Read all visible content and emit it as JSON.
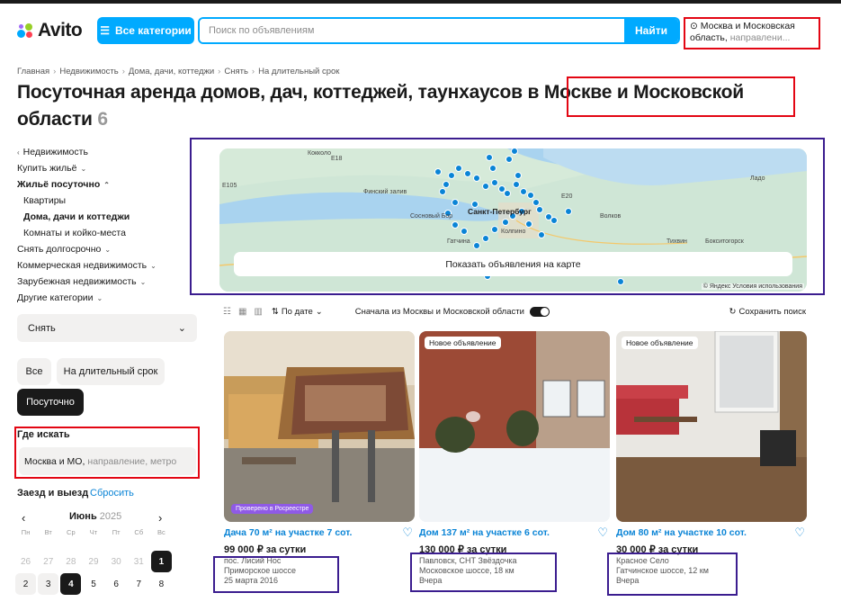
{
  "header": {
    "logo_text": "Avito",
    "categories_button": "Все категории",
    "search_placeholder": "Поиск по объявлениям",
    "search_button": "Найти",
    "location_main": "Москва и Московская",
    "location_line2_a": "область,",
    "location_line2_b": "направлени..."
  },
  "breadcrumb": [
    "Главная",
    "Недвижимость",
    "Дома, дачи, коттеджи",
    "Снять",
    "На длительный срок"
  ],
  "page": {
    "title": "Посуточная аренда домов, дач, коттеджей, таунхаусов в Москве и Московской области",
    "count": "6"
  },
  "sidebar": {
    "items": [
      {
        "label": "Недвижимость",
        "prefix": "‹"
      },
      {
        "label": "Купить жильё",
        "chevron": "⌄"
      },
      {
        "label": "Жильё посуточно",
        "chevron": "⌃"
      },
      {
        "label": "Квартиры"
      },
      {
        "label": "Дома, дачи и коттеджи"
      },
      {
        "label": "Комнаты и койко-места"
      },
      {
        "label": "Снять долгосрочно",
        "chevron": "⌄"
      },
      {
        "label": "Коммерческая недвижимость",
        "chevron": "⌄"
      },
      {
        "label": "Зарубежная недвижимость",
        "chevron": "⌄"
      },
      {
        "label": "Другие категории",
        "chevron": "⌄"
      }
    ],
    "deal_select": "Снять",
    "chips": [
      "Все",
      "На длительный срок",
      "Посуточно"
    ],
    "where_label": "Где искать",
    "where_value": "Москва и МО,",
    "where_placeholder": "направление, метро",
    "dates_label": "Заезд и выезд",
    "dates_reset": "Сбросить",
    "calendar": {
      "month": "Июнь",
      "year": "2025",
      "weekdays": [
        "Пн",
        "Вт",
        "Ср",
        "Чт",
        "Пт",
        "Сб",
        "Вс"
      ],
      "row1": [
        "26",
        "27",
        "28",
        "29",
        "30",
        "31",
        "1"
      ],
      "row2": [
        "2",
        "3",
        "4",
        "5",
        "6",
        "7",
        "8"
      ]
    }
  },
  "map": {
    "show_button": "Показать объявления на карте",
    "copyright": "© Яндекс Условия использования",
    "city": "Санкт-Петербург",
    "labels": [
      "Кокколо",
      "Финский залив",
      "Сосновый Бор",
      "Колпино",
      "Волков",
      "Тихвин",
      "E18",
      "E105",
      "E20",
      "Ладо",
      "Гатчина",
      "Бокситогорск"
    ]
  },
  "toolbar": {
    "sort_label": "По дате",
    "toggle_label": "Сначала из Москвы и Московской области",
    "save_search": "Сохранить поиск"
  },
  "listings": [
    {
      "badge": "",
      "verified": "Проверено в Росреестре",
      "title": "Дача 70 м² на участке 7 сот.",
      "price": "99 000 ₽ за сутки",
      "meta": [
        "пос. Лисий Нос",
        "Приморское шоссе",
        "25 марта 2016"
      ]
    },
    {
      "badge": "Новое объявление",
      "verified": "",
      "title": "Дом 137 м² на участке 6 сот.",
      "price": "130 000 ₽ за сутки",
      "meta": [
        "Павловск, СНТ Звёздочка",
        "Московское шоссе, 18 км",
        "Вчера"
      ]
    },
    {
      "badge": "Новое объявление",
      "verified": "",
      "title": "Дом 80 м² на участке 10 сот.",
      "price": "30 000 ₽ за сутки",
      "meta": [
        "Красное Село",
        "Гатчинское шоссе, 12 км",
        "Вчера"
      ]
    }
  ],
  "colors": {
    "accent": "#00aaff",
    "link": "#0a84d6",
    "highlight_red": "#e30613",
    "highlight_purple": "#3b1d8f",
    "verified_badge": "#8f5ae6"
  }
}
